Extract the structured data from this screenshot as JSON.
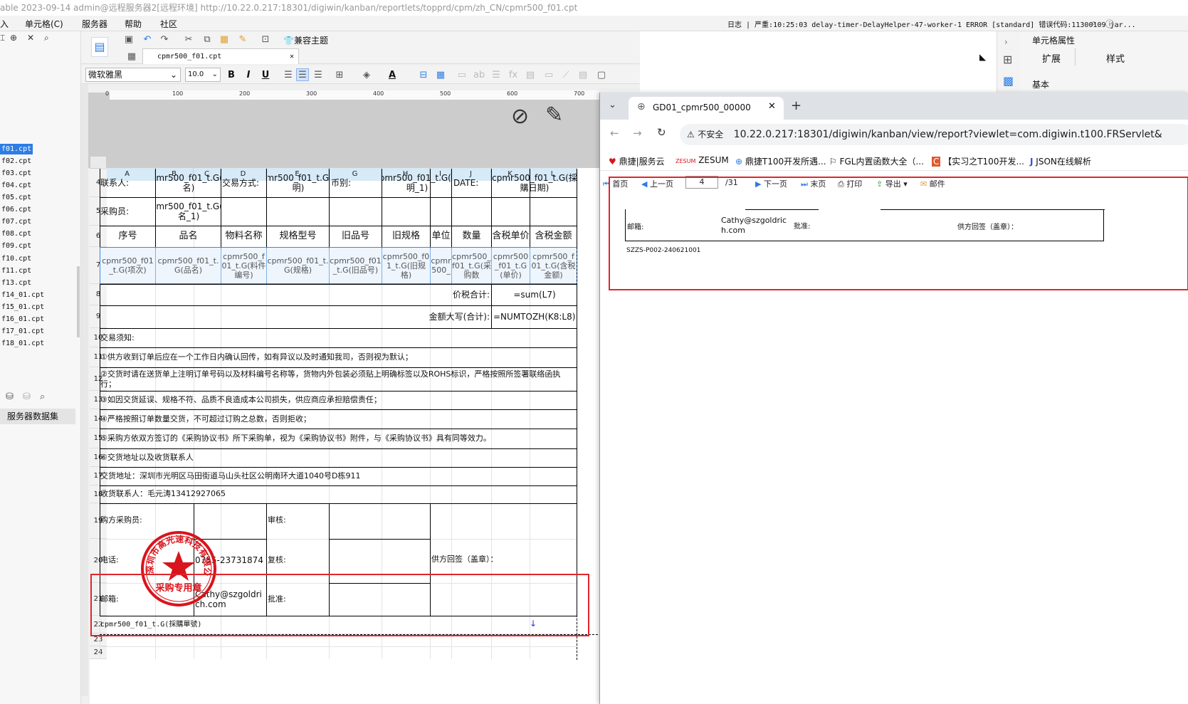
{
  "title_bar": "able 2023-09-14 admin@远程服务器2[远程环境]    http://10.22.0.217:18301/digiwin/kanban/reportlets/topprd/cpm/zh_CN/cpmr500_f01.cpt",
  "menu": {
    "item0": "入",
    "item1": "单元格(C)",
    "item2": "服务器",
    "item3": "帮助",
    "item4": "社区"
  },
  "log": "日志 | 严重:10:25:03 delay-timer-DelayHelper-47-worker-1 ERROR [standard] 错误代码:11300109 jar...",
  "left_files": [
    "f01.cpt",
    "f02.cpt",
    "f03.cpt",
    "f04.cpt",
    "f05.cpt",
    "f06.cpt",
    "f07.cpt",
    "f08.cpt",
    "f09.cpt",
    "f10.cpt",
    "f11.cpt",
    "f13.cpt",
    "f14_01.cpt",
    "f15_01.cpt",
    "f16_01.cpt",
    "f17_01.cpt",
    "f18_01.cpt"
  ],
  "left_dataset_label": "服务器数据集",
  "editor": {
    "compat_theme": "兼容主题",
    "file_tab": "cpmr500_f01.cpt",
    "font_name": "微软雅黑",
    "font_size": "10.0"
  },
  "ruler": [
    "0",
    "100",
    "200",
    "300",
    "400",
    "500",
    "600",
    "700"
  ],
  "columns": [
    "A",
    "B",
    "C",
    "D",
    "E",
    "G",
    "H",
    "I",
    "J",
    "K",
    "L"
  ],
  "rows": [
    "4",
    "5",
    "6",
    "7",
    "8",
    "9",
    "10",
    "11",
    "12",
    "13",
    "14",
    "15",
    "16",
    "17",
    "18",
    "19",
    "20",
    "21",
    "22",
    "23",
    "24"
  ],
  "sheet": {
    "r4_a": "联系人:",
    "r4_b": "cpmr500_f01_t.G(全名)",
    "r4_d": "交易方式:",
    "r4_e": "cpmr500_f01_t.G(說明)",
    "r4_g": "币别:",
    "r4_h": "cpmr500_f01_t.G(說明_1)",
    "r4_j": "DATE:",
    "r4_k": "cpmr500_f01_t.G(採購日期)",
    "r5_a": "采购员:",
    "r5_b": "cpmr500_f01_t.G(全名_1)",
    "r6": [
      "序号",
      "品名",
      "物料名称",
      "规格型号",
      "旧品号",
      "旧规格",
      "单位",
      "数量",
      "含税单价",
      "含税金额"
    ],
    "r7": [
      "cpmr500_f01_t.G(项次)",
      "cpmr500_f01_t.G(品名)",
      "cpmr500_f01_t.G(料件编号)",
      "cpmr500_f01_t.G(规格)",
      "cpmr500_f01_t.G(旧品号)",
      "cpmr500_f01_t.G(旧规格)",
      "cpmr500_",
      "cpmr500_f01_t.G(采购数",
      "cpmr500_f01_t.G(单价)",
      "cpmr500_f01_t.G(含税金额)"
    ],
    "r8_label": "价税合计:",
    "r8_val": "=sum(L7)",
    "r9_label": "金额大写(合计):",
    "r9_val": "=NUMTOZH(K8:L8)",
    "r10": "交易须知:",
    "r11": "①供方收到订单后应在一个工作日内确认回传，如有异议以及时通知我司，否则视为默认；",
    "r12": "②交货时请在送货单上注明订单号码以及材料编号名称等，货物内外包装必须贴上明确标签以及ROHS标识，严格按照所签署联络函执行；",
    "r13": "③如因交货延误、规格不符、品质不良造成本公司损失，供应商应承担赔偿责任；",
    "r14": "④严格按照订单数量交货，不可超过订购之总数，否则拒收；",
    "r15": "⑤采购方依双方签订的《采购协议书》所下采购单，视为《采购协议书》附件，与《采购协议书》具有同等效力。",
    "r16": "⑥交货地址以及收货联系人",
    "r17": "交货地址：深圳市光明区马田街道马山头社区公明南环大道1040号D栋911",
    "r18": "收货联系人：毛元涛13412927065",
    "r19_a": "购方采购员:",
    "r19_d": "审核:",
    "r20_a": "电话:",
    "r20_b": "0755-23731874",
    "r20_d": "复核:",
    "r20_supplier": "供方回签（盖章）：",
    "r21_a": "邮箱:",
    "r21_b": "Cathy@szgoldrich.com",
    "r21_d": "批准:",
    "r22": "cpmr500_f01_t.G(採購單號)"
  },
  "stamp": {
    "ring_text": "深圳市高光速科技有限公司",
    "center": "采购专用章"
  },
  "right_panel": {
    "title": "单元格属性",
    "tab1": "扩展",
    "tab2": "样式",
    "section": "基本"
  },
  "browser": {
    "tab_title": "GD01_cpmr500_00000",
    "insecure": "不安全",
    "url": "10.22.0.217:18301/digiwin/kanban/view/report?viewlet=com.digiwin.t100.FRServlet&",
    "bookmarks": [
      "鼎捷|服务云",
      "ZESUM",
      "鼎捷T100开发所遇...",
      "FGL内置函数大全（...",
      "【实习之T100开发...",
      "JSON在线解析"
    ],
    "toolbar": {
      "first": "首页",
      "prev": "上一页",
      "page": "4",
      "total": "/31",
      "next": "下一页",
      "last": "末页",
      "print": "打印",
      "export": "导出",
      "mail": "邮件"
    },
    "report": {
      "mail_label": "邮箱:",
      "mail_value": "Cathy@szgoldrich.com",
      "approve": "批准:",
      "supplier": "供方回签（盖章）：",
      "order_no": "SZZS-P002-240621001"
    }
  },
  "colors": {
    "accent": "#2d7de4",
    "highlight_box": "#e0262b",
    "stamp": "#d9141c"
  }
}
